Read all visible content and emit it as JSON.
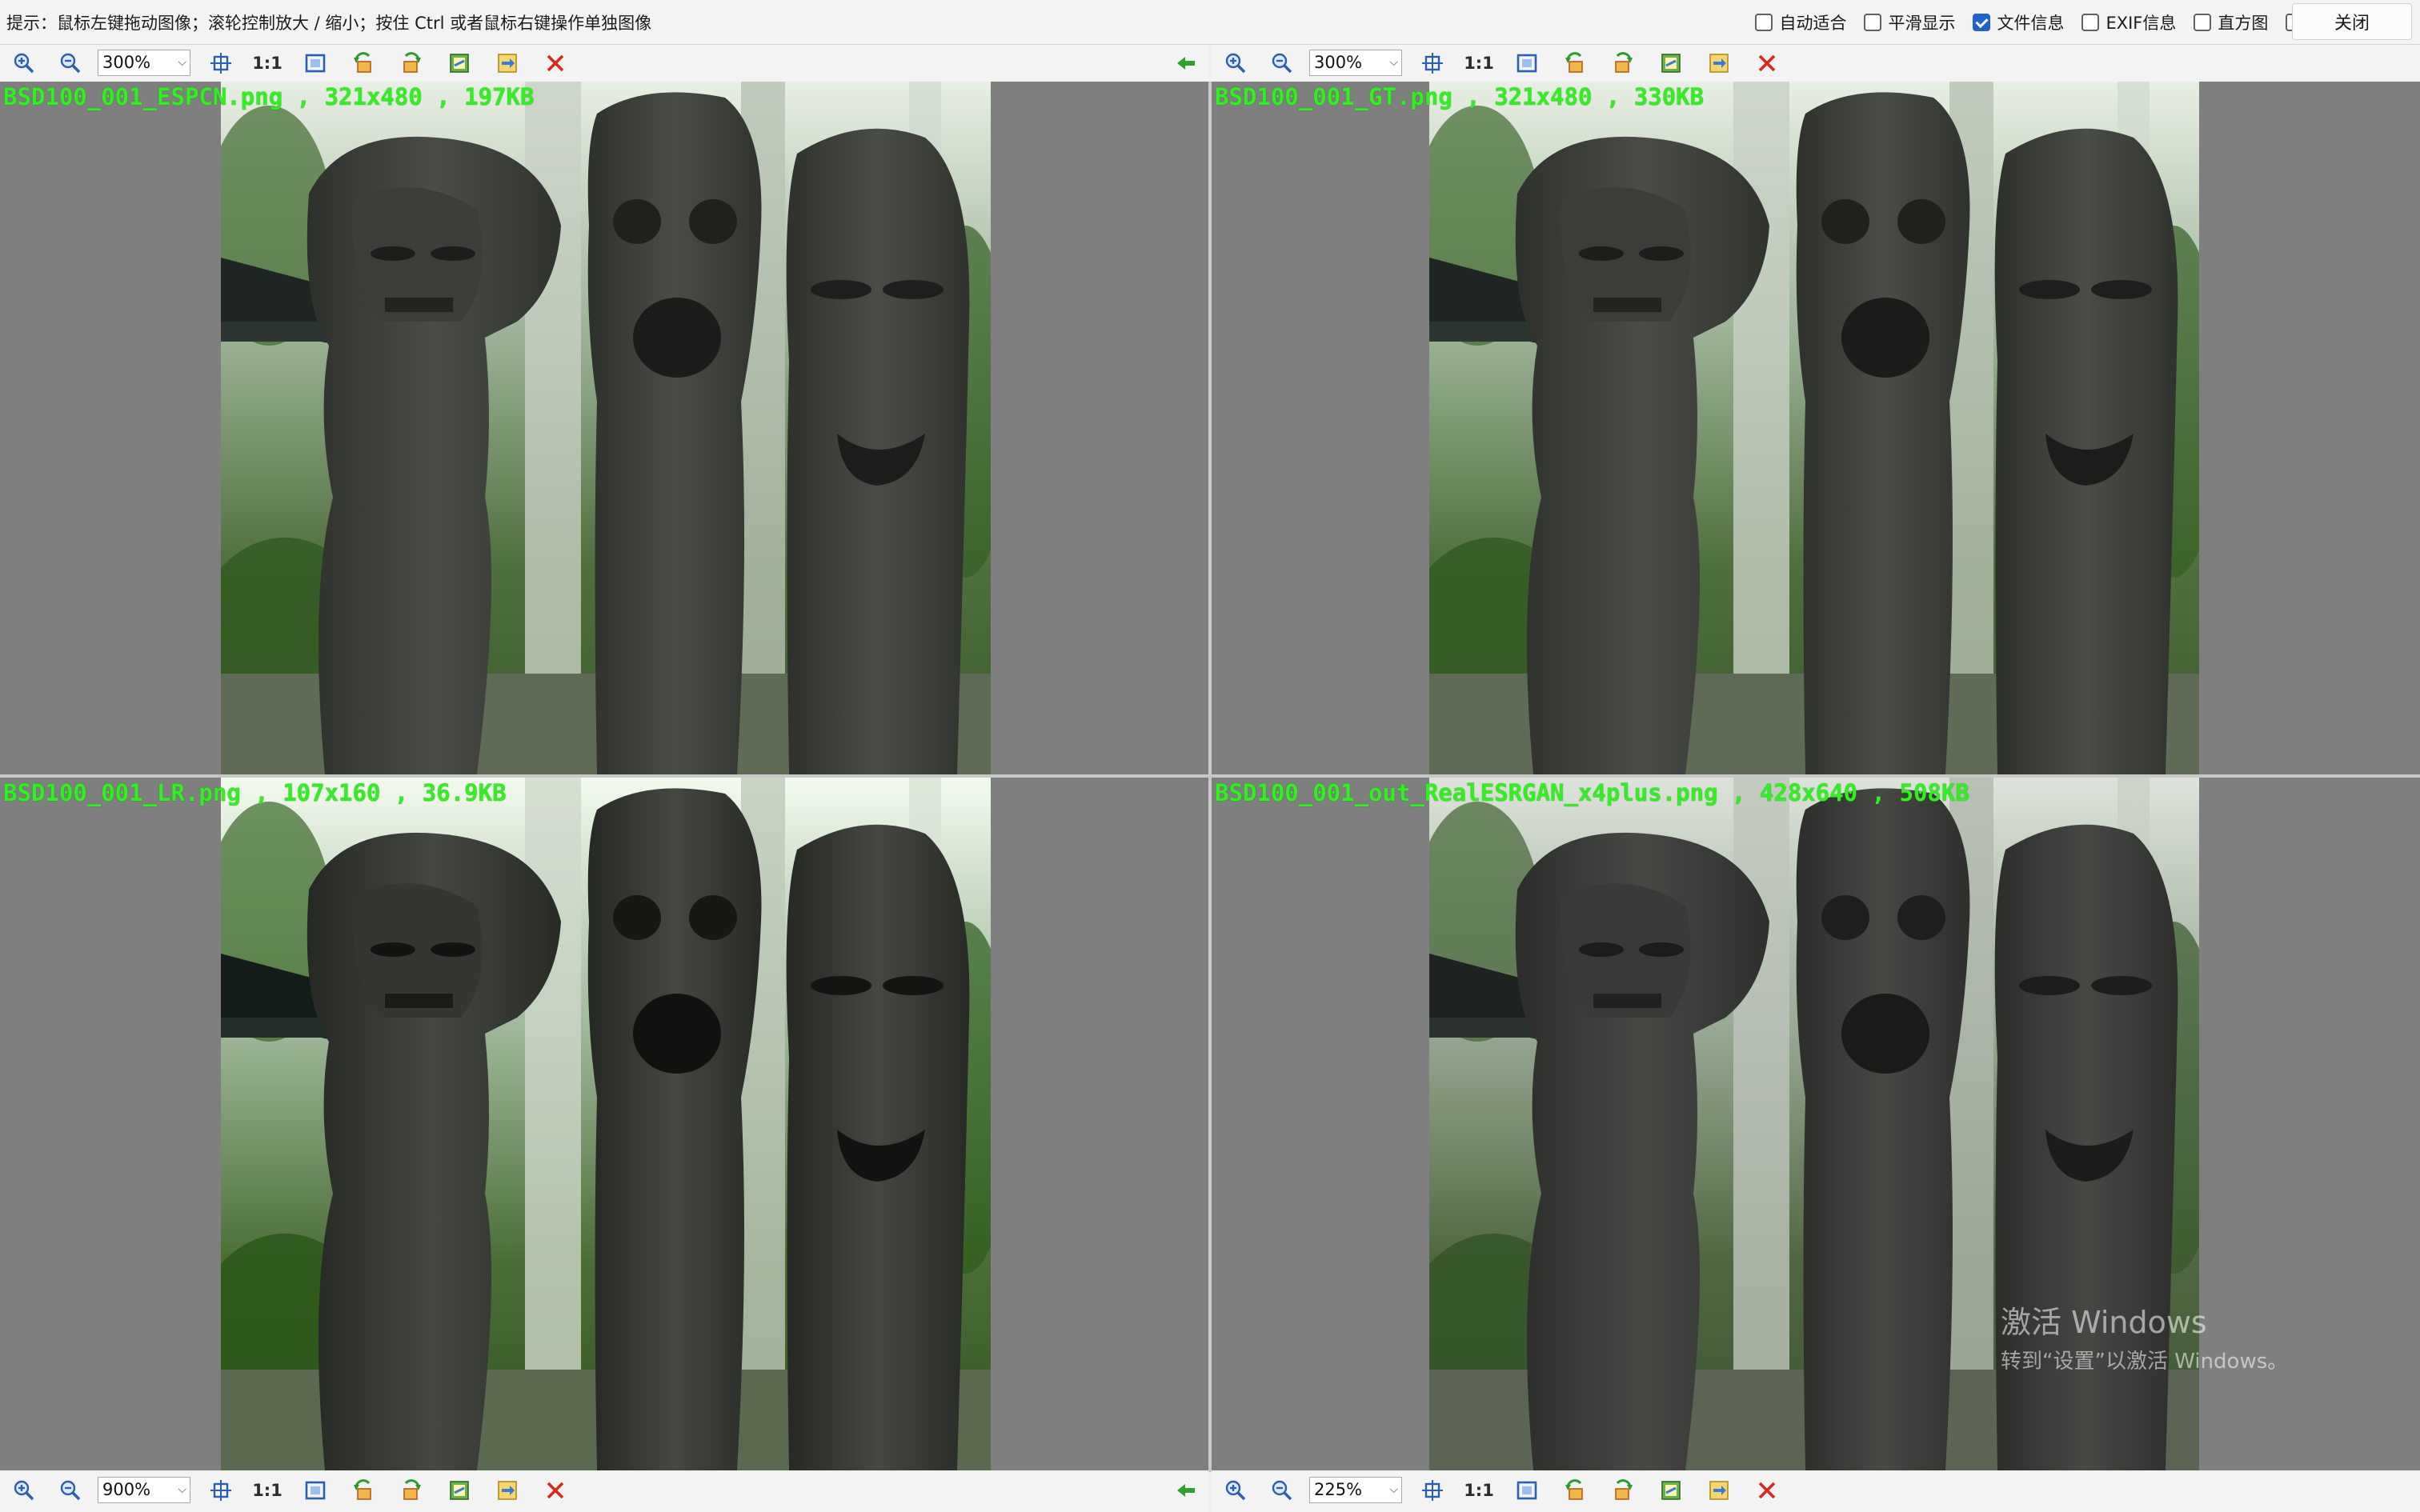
{
  "hint": "提示：鼠标左键拖动图像；滚轮控制放大 / 缩小；按住 Ctrl 或者鼠标右键操作单独图像",
  "options": [
    {
      "label": "自动适合",
      "checked": false
    },
    {
      "label": "平滑显示",
      "checked": false
    },
    {
      "label": "文件信息",
      "checked": true
    },
    {
      "label": "EXIF信息",
      "checked": false
    },
    {
      "label": "直方图",
      "checked": false
    },
    {
      "label": "+",
      "checked": false
    }
  ],
  "close_label": "关闭",
  "one_to_one": "1:1",
  "toolbars": {
    "top_left": {
      "zoom": "300%"
    },
    "top_right": {
      "zoom": "300%"
    },
    "bottom_left": {
      "zoom": "900%"
    },
    "bottom_right": {
      "zoom": "225%"
    }
  },
  "panes": {
    "top_left": {
      "caption": "BSD100_001_ESPCN.png , 321x480 , 197KB"
    },
    "top_right": {
      "caption": "BSD100_001_GT.png , 321x480 , 330KB"
    },
    "bottom_left": {
      "caption": "BSD100_001_LR.png , 107x160 , 36.9KB"
    },
    "bottom_right": {
      "caption": "BSD100_001_out_RealESRGAN_x4plus.png , 428x640 , 508KB"
    }
  },
  "watermark": {
    "line1": "激活 Windows",
    "line2": "转到“设置”以激活 Windows。"
  },
  "colors": {
    "caption": "#33ee22",
    "pane_bg": "#7f7f7f",
    "checkbox_on": "#1f62c9",
    "close_x": "#d42a1f"
  }
}
